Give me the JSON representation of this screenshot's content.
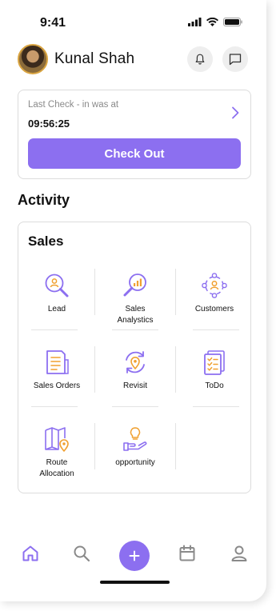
{
  "status_bar": {
    "time": "9:41"
  },
  "header": {
    "user_name": "Kunal Shah"
  },
  "last_check": {
    "label": "Last Check - in was at",
    "time": "09:56:25",
    "button_label": "Check Out"
  },
  "activity_title": "Activity",
  "sales": {
    "title": "Sales",
    "tiles": [
      {
        "label": "Lead",
        "icon": "lead-search-icon"
      },
      {
        "label": "Sales\nAnalystics",
        "icon": "sales-analytics-icon"
      },
      {
        "label": "Customers",
        "icon": "customers-icon"
      },
      {
        "label": "Sales Orders",
        "icon": "sales-orders-icon"
      },
      {
        "label": "Revisit",
        "icon": "revisit-icon"
      },
      {
        "label": "ToDo",
        "icon": "todo-icon"
      },
      {
        "label": "Route\nAllocation",
        "icon": "route-allocation-icon"
      },
      {
        "label": "opportunity",
        "icon": "opportunity-icon"
      }
    ]
  },
  "colors": {
    "accent": "#8c6ff0",
    "icon_orange": "#f0a030"
  }
}
